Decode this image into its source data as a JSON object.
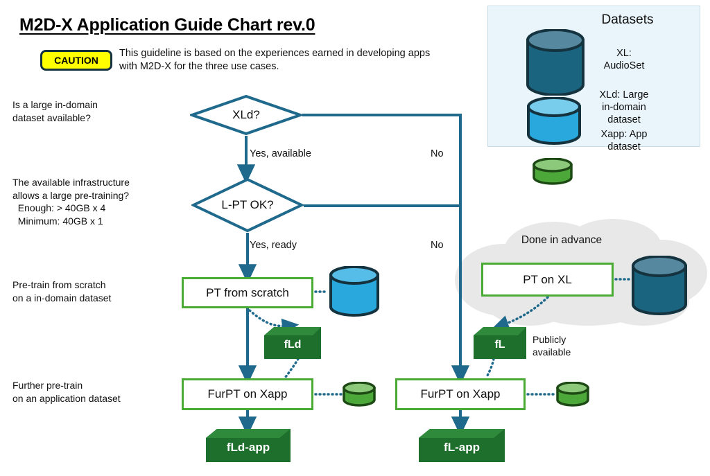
{
  "title": "M2D-X Application Guide Chart rev.0",
  "caution": {
    "badge_label": "CAUTION",
    "note": "This guideline is based on the experiences earned in developing apps with M2D-X for the three use cases."
  },
  "colors": {
    "flow_line": "#1f6a8c",
    "process_border": "#4aab34",
    "model_green_dark": "#1d6f2b",
    "model_green_light": "#2f8a3c",
    "caution_yellow": "#ffff00",
    "caution_border": "#15313f",
    "panel_bg": "#e9f5fb",
    "panel_border": "#c9dbe4",
    "cloud_gray": "#e8e8e8",
    "cylinder_xl": "#1b6480",
    "cylinder_xld": "#29a8de",
    "cylinder_xapp": "#4da83a"
  },
  "side_labels": [
    {
      "name": "question-1",
      "text": "Is a large in-domain\ndataset available?"
    },
    {
      "name": "question-2",
      "text": "The available infrastructure\nallows a large pre-training?\n  Enough: > 40GB x 4\n  Minimum: 40GB x 1"
    },
    {
      "name": "question-3",
      "text": "Pre-train from scratch\non a in-domain dataset"
    },
    {
      "name": "question-4",
      "text": "Further pre-train\non an application dataset"
    }
  ],
  "nodes": {
    "decision_xld": "XLd?",
    "decision_lpt": "L-PT\nOK?",
    "process_pt_from_scratch": "PT from scratch",
    "process_furpt_xapp_left": "FurPT on Xapp",
    "process_pt_on_xl": "PT on XL",
    "process_furpt_xapp_right": "FurPT on Xapp",
    "model_fld": "fLd",
    "model_fl": "fL",
    "model_fld_app": "fLd-app",
    "model_fl_app": "fL-app"
  },
  "edge_labels": {
    "yes_available": "Yes, available",
    "yes_ready": "Yes, ready",
    "no_1": "No",
    "no_2": "No"
  },
  "cloud": {
    "label": "Done in advance"
  },
  "annotations": {
    "publicly_available": "Publicly\navailable"
  },
  "datasets_panel": {
    "title": "Datasets",
    "items": [
      {
        "icon": "database-cylinder-xl-icon",
        "text": "XL:\nAudioSet"
      },
      {
        "icon": "database-cylinder-xld-icon",
        "text": "XLd: Large\nin-domain\ndataset"
      },
      {
        "icon": "database-cylinder-xapp-icon",
        "text": "Xapp: App\ndataset"
      }
    ]
  }
}
